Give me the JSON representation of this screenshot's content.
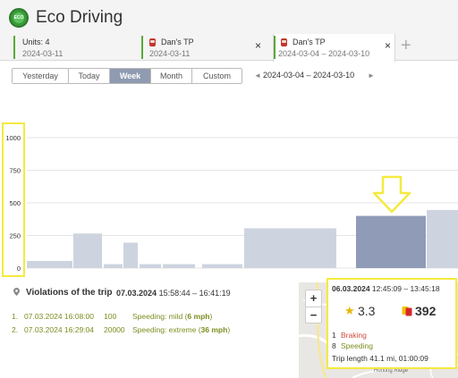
{
  "app": {
    "title": "Eco Driving",
    "logo_text": "ECO"
  },
  "tabs": [
    {
      "title": "Units: 4",
      "subtitle": "2024-03-11"
    },
    {
      "title": "Dan's TP",
      "subtitle": "2024-03-11",
      "close": "×"
    },
    {
      "title": "Dan's TP",
      "subtitle": "2024-03-04  –  2024-03-10",
      "close": "×"
    }
  ],
  "add_tab": "+",
  "periods": [
    "Yesterday",
    "Today",
    "Week",
    "Month",
    "Custom"
  ],
  "active_period": "Week",
  "range": {
    "prev": "◄",
    "label": "2024-03-04  –  2024-03-10",
    "next": "►"
  },
  "chart_data": {
    "type": "bar",
    "y_ticks": [
      0,
      250,
      500,
      750,
      1000
    ],
    "ylim": [
      0,
      1150
    ],
    "values": [
      55,
      265,
      30,
      195,
      30,
      30,
      30,
      305,
      400,
      445
    ],
    "selected_index": 8,
    "colors": {
      "bar": "#cdd4df",
      "selected": "#8f9bb7",
      "grid": "#e4e4e4"
    }
  },
  "highlight_color": "#f5ea3f",
  "violations": {
    "title": "Violations of the trip",
    "trip_date": "07.03.2024",
    "trip_time": "15:58:44 – 16:41:19",
    "rows": [
      {
        "num": "1.",
        "datetime": "07.03.2024 16:08:00",
        "value": "100",
        "type": "Speeding: mild (",
        "speed": "6 mph",
        "end": ")"
      },
      {
        "num": "2.",
        "datetime": "07.03.2024 16:29:04",
        "value": "20000",
        "type": "Speeding: extreme (",
        "speed": "36 mph",
        "end": ")"
      }
    ]
  },
  "map": {
    "zoom_in": "+",
    "zoom_out": "−",
    "place_label": "Hunting Ridge"
  },
  "info_card": {
    "date": "06.03.2024",
    "time": "12:45:09 – 13:45:18",
    "rating": "3.3",
    "points": "392",
    "events": [
      {
        "count": "1",
        "label": "Braking",
        "color": "#d14a3a"
      },
      {
        "count": "8",
        "label": "Speeding",
        "color": "#7a8f20"
      }
    ],
    "trip_length": "Trip length 41.1 mi, 01:00:09"
  }
}
